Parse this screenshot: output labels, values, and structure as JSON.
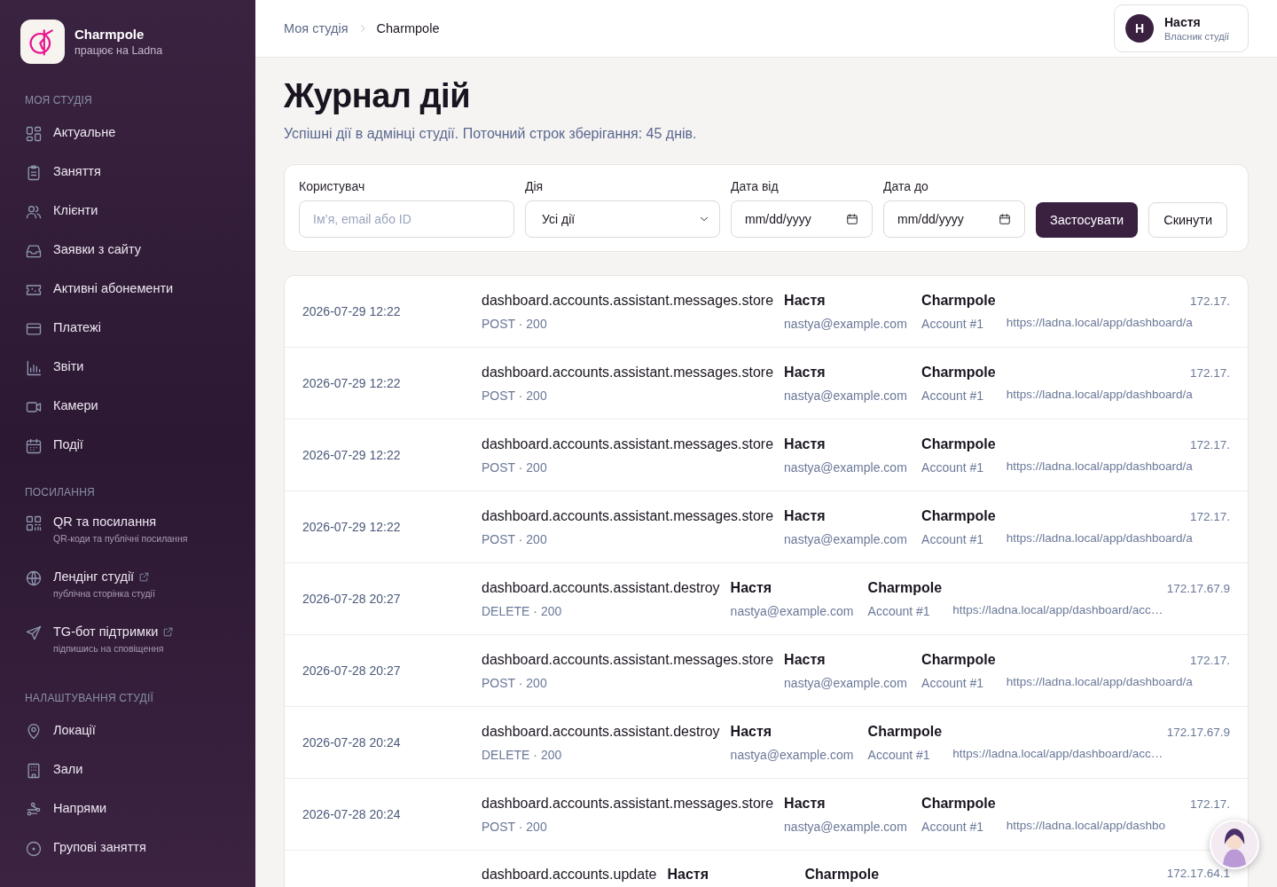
{
  "brand": {
    "name": "Charmpole",
    "tagline": "працює на Ladna"
  },
  "sidebar": {
    "sections": [
      {
        "title": "МОЯ СТУДІЯ",
        "items": [
          {
            "label": "Актуальне"
          },
          {
            "label": "Заняття"
          },
          {
            "label": "Клієнти"
          },
          {
            "label": "Заявки з сайту"
          },
          {
            "label": "Активні абонементи"
          },
          {
            "label": "Платежі"
          },
          {
            "label": "Звіти"
          },
          {
            "label": "Камери"
          },
          {
            "label": "Події"
          }
        ]
      },
      {
        "title": "ПОСИЛАННЯ",
        "items": [
          {
            "label": "QR та посилання",
            "subtitle": "QR-коди та публічні посилання",
            "external": false
          },
          {
            "label": "Лендінг студії",
            "subtitle": "публічна сторінка студії",
            "external": true
          },
          {
            "label": "TG-бот підтримки",
            "subtitle": "підпишись на сповіщення",
            "external": true
          }
        ]
      },
      {
        "title": "НАЛАШТУВАННЯ СТУДІЇ",
        "items": [
          {
            "label": "Локації"
          },
          {
            "label": "Зали"
          },
          {
            "label": "Напрями"
          },
          {
            "label": "Групові заняття"
          }
        ]
      }
    ]
  },
  "breadcrumbs": [
    "Моя студія",
    "Charmpole"
  ],
  "user": {
    "initial": "Н",
    "name": "Настя",
    "role": "Власник студії"
  },
  "page": {
    "title": "Журнал дій",
    "subtitle": "Успішні дії в адмінці студії. Поточний строк зберігання: 45 днів."
  },
  "filters": {
    "user": {
      "label": "Користувач",
      "placeholder": "Ім’я, email або ID"
    },
    "action": {
      "label": "Дія",
      "value": "Усі дії"
    },
    "date_from": {
      "label": "Дата від",
      "value": "mm/dd/yyyy"
    },
    "date_to": {
      "label": "Дата до",
      "value": "mm/dd/yyyy"
    },
    "buttons": [
      {
        "label": "Застосувати",
        "kind": "primary"
      },
      {
        "label": "Скинути",
        "kind": "secondary"
      }
    ]
  },
  "log": [
    {
      "date": "2026-07-29 12:22",
      "action": "dashboard.accounts.assistant.messages.store",
      "request": "POST · 200",
      "user_name": "Настя",
      "user_email": "nastya@example.com",
      "account": "Charmpole",
      "account_sub": "Account #1",
      "ip": "172.17.",
      "url": "https://ladna.local/app/dashboard/a"
    },
    {
      "date": "2026-07-29 12:22",
      "action": "dashboard.accounts.assistant.messages.store",
      "request": "POST · 200",
      "user_name": "Настя",
      "user_email": "nastya@example.com",
      "account": "Charmpole",
      "account_sub": "Account #1",
      "ip": "172.17.",
      "url": "https://ladna.local/app/dashboard/a"
    },
    {
      "date": "2026-07-29 12:22",
      "action": "dashboard.accounts.assistant.messages.store",
      "request": "POST · 200",
      "user_name": "Настя",
      "user_email": "nastya@example.com",
      "account": "Charmpole",
      "account_sub": "Account #1",
      "ip": "172.17.",
      "url": "https://ladna.local/app/dashboard/a"
    },
    {
      "date": "2026-07-29 12:22",
      "action": "dashboard.accounts.assistant.messages.store",
      "request": "POST · 200",
      "user_name": "Настя",
      "user_email": "nastya@example.com",
      "account": "Charmpole",
      "account_sub": "Account #1",
      "ip": "172.17.",
      "url": "https://ladna.local/app/dashboard/a"
    },
    {
      "date": "2026-07-28 20:27",
      "action": "dashboard.accounts.assistant.destroy",
      "request": "DELETE · 200",
      "user_name": "Настя",
      "user_email": "nastya@example.com",
      "account": "Charmpole",
      "account_sub": "Account #1",
      "ip": "172.17.67.9",
      "url": "https://ladna.local/app/dashboard/acc…"
    },
    {
      "date": "2026-07-28 20:27",
      "action": "dashboard.accounts.assistant.messages.store",
      "request": "POST · 200",
      "user_name": "Настя",
      "user_email": "nastya@example.com",
      "account": "Charmpole",
      "account_sub": "Account #1",
      "ip": "172.17.",
      "url": "https://ladna.local/app/dashboard/a"
    },
    {
      "date": "2026-07-28 20:24",
      "action": "dashboard.accounts.assistant.destroy",
      "request": "DELETE · 200",
      "user_name": "Настя",
      "user_email": "nastya@example.com",
      "account": "Charmpole",
      "account_sub": "Account #1",
      "ip": "172.17.67.9",
      "url": "https://ladna.local/app/dashboard/acc…"
    },
    {
      "date": "2026-07-28 20:24",
      "action": "dashboard.accounts.assistant.messages.store",
      "request": "POST · 200",
      "user_name": "Настя",
      "user_email": "nastya@example.com",
      "account": "Charmpole",
      "account_sub": "Account #1",
      "ip": "172.17.",
      "url": "https://ladna.local/app/dashbo"
    },
    {
      "action": "dashboard.accounts.update",
      "user_name": "Настя",
      "account": "Charmpole",
      "ip": "172.17.64.1"
    }
  ]
}
